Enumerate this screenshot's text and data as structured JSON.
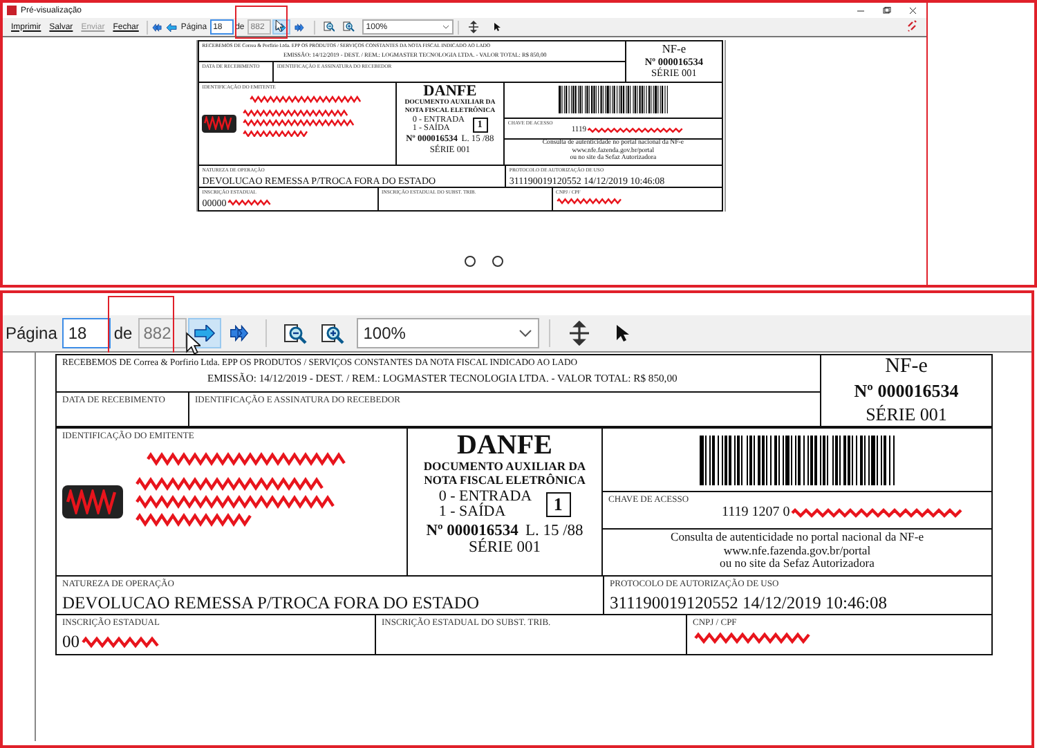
{
  "preview_window": {
    "title": "Pré-visualização",
    "commands": [
      {
        "label": "Imprimir",
        "disabled": false
      },
      {
        "label": "Salvar",
        "disabled": false
      },
      {
        "label": "Enviar",
        "disabled": true
      },
      {
        "label": "Fechar",
        "disabled": false
      }
    ],
    "toolbar": {
      "page_label": "Página",
      "page": "18",
      "of_label": "de",
      "page_count": "882",
      "zoom": "100%"
    },
    "document": {
      "receipt": {
        "text": "RECEBEMOS DE Correa & Porfirio Ltda. EPP OS PRODUTOS / SERVIÇOS CONSTANTES DA NOTA FISCAL INDICADO AO LADO",
        "summary": "EMISSÃO: 14/12/2019  -  DEST. / REM.: LOGMASTER TECNOLOGIA LTDA.  -  VALOR TOTAL: R$ 850,00",
        "date_label": "DATA DE RECEBIMENTO",
        "signature_label": "IDENTIFICAÇÃO E ASSINATURA DO RECEBEDOR"
      },
      "stub": {
        "title": "NF-e",
        "number": "Nº 000016534",
        "series": "SÉRIE 001"
      },
      "issuer": {
        "label": "IDENTIFICAÇÃO DO EMITENTE"
      },
      "danfe": {
        "title": "DANFE",
        "subtitle": "DOCUMENTO AUXILIAR DA NOTA FISCAL ELETRÔNICA",
        "entry": "0 - ENTRADA",
        "exit": "1 - SAÍDA",
        "type": "1",
        "number": "Nº 000016534",
        "sheet": "L. 15 /88",
        "series": "SÉRIE 001"
      },
      "access_key": {
        "label": "CHAVE DE ACESSO",
        "value": "1119"
      },
      "consult": [
        "Consulta de autenticidade no portal nacional da NF-e",
        "www.nfe.fazenda.gov.br/portal",
        "ou no site da Sefaz Autorizadora"
      ],
      "nature": {
        "label": "NATUREZA DE OPERAÇÃO",
        "value": "DEVOLUCAO REMESSA P/TROCA FORA DO ESTADO"
      },
      "protocol": {
        "label": "PROTOCOLO DE AUTORIZAÇÃO DE USO",
        "value": "311190019120552 14/12/2019 10:46:08"
      },
      "state_registration": {
        "label": "INSCRIÇÃO ESTADUAL",
        "value": "00000"
      },
      "subst_registration": {
        "label": "INSCRIÇÃO ESTADUAL DO SUBST. TRIB."
      },
      "tax_id": {
        "label": "CNPJ / CPF"
      }
    }
  },
  "detail_view": {
    "toolbar": {
      "page_label": "Página",
      "page": "18",
      "of_label": "de",
      "page_count": "882",
      "zoom": "100%"
    },
    "document": {
      "receipt": {
        "text": "RECEBEMOS DE Correa & Porfirio Ltda. EPP OS PRODUTOS / SERVIÇOS CONSTANTES DA NOTA FISCAL INDICADO AO LADO",
        "summary": "EMISSÃO: 14/12/2019  -  DEST. / REM.: LOGMASTER TECNOLOGIA LTDA.  -  VALOR TOTAL: R$ 850,00",
        "date_label": "DATA DE RECEBIMENTO",
        "signature_label": "IDENTIFICAÇÃO E ASSINATURA DO RECEBEDOR"
      },
      "stub": {
        "title": "NF-e",
        "number": "Nº 000016534",
        "series": "SÉRIE 001"
      },
      "issuer": {
        "label": "IDENTIFICAÇÃO DO EMITENTE"
      },
      "danfe": {
        "title": "DANFE",
        "subtitle": "DOCUMENTO AUXILIAR DA NOTA FISCAL ELETRÔNICA",
        "entry": "0 - ENTRADA",
        "exit": "1 - SAÍDA",
        "type": "1",
        "number": "Nº 000016534",
        "sheet": "L. 15 /88",
        "series": "SÉRIE 001"
      },
      "access_key": {
        "label": "CHAVE DE ACESSO",
        "value": "1119 1207 0"
      },
      "consult": [
        "Consulta de autenticidade no portal nacional da NF-e",
        "www.nfe.fazenda.gov.br/portal",
        "ou no site da Sefaz Autorizadora"
      ],
      "nature": {
        "label": "NATUREZA DE OPERAÇÃO",
        "value": "DEVOLUCAO REMESSA P/TROCA FORA DO ESTADO"
      },
      "protocol": {
        "label": "PROTOCOLO DE AUTORIZAÇÃO DE USO",
        "value": "311190019120552 14/12/2019 10:46:08"
      },
      "state_registration": {
        "label": "INSCRIÇÃO ESTADUAL",
        "value": "00"
      },
      "subst_registration": {
        "label": "INSCRIÇÃO ESTADUAL DO SUBST. TRIB."
      },
      "tax_id": {
        "label": "CNPJ / CPF"
      }
    }
  }
}
